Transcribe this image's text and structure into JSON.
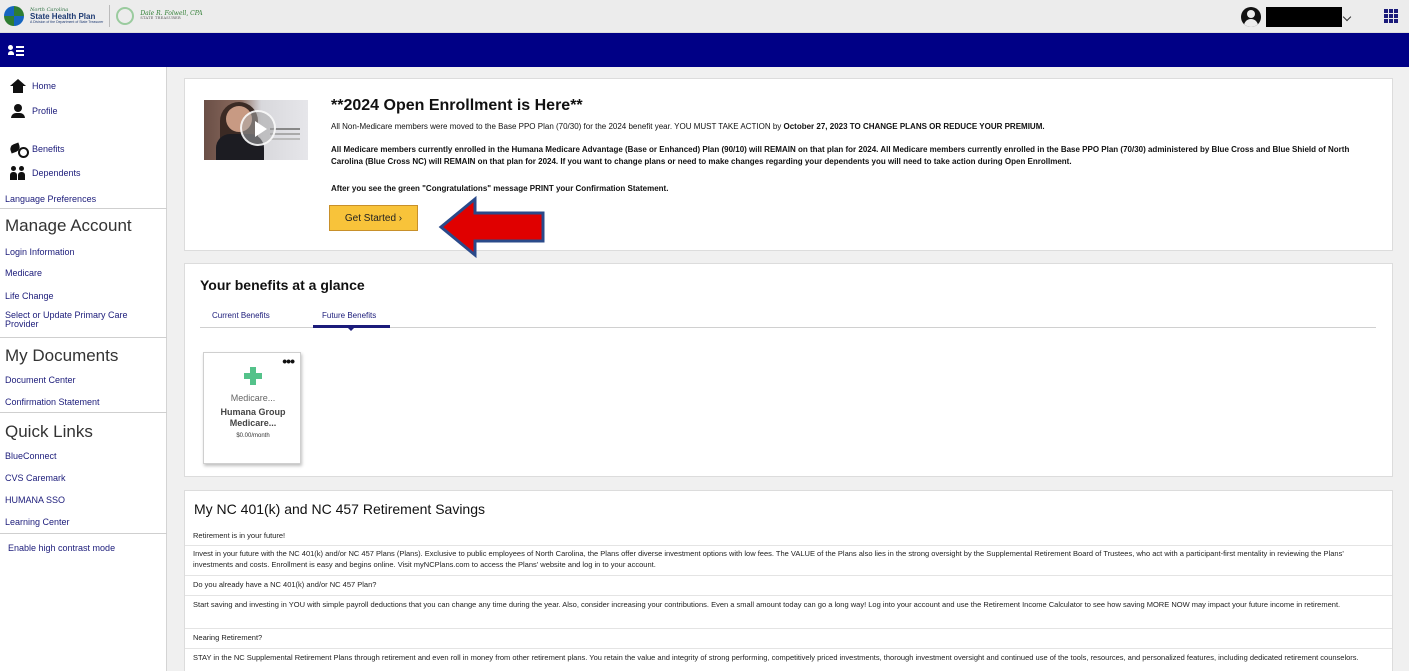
{
  "header": {
    "logo": {
      "tagline_top": "North Carolina",
      "name": "State Health Plan",
      "subtitle": "A Division of the Department of State Treasurer",
      "signature": "Dale R. Folwell, CPA",
      "signature_sub": "STATE TREASURER"
    }
  },
  "sidebar": {
    "nav": [
      {
        "label": "Home",
        "icon": "home-icon"
      },
      {
        "label": "Profile",
        "icon": "profile-icon"
      },
      {
        "label": "Benefits",
        "icon": "benefits-icon"
      },
      {
        "label": "Dependents",
        "icon": "dependents-icon"
      }
    ],
    "language": "Language Preferences",
    "manage_heading": "Manage Account",
    "manage_items": [
      "Login Information",
      "Medicare",
      "Life Change",
      "Select or Update Primary Care Provider"
    ],
    "documents_heading": "My Documents",
    "documents_items": [
      "Document Center",
      "Confirmation Statement"
    ],
    "quick_heading": "Quick Links",
    "quick_items": [
      "BlueConnect",
      "CVS Caremark",
      "HUMANA SSO",
      "Learning Center"
    ],
    "contrast": "Enable high contrast mode"
  },
  "enrollment": {
    "title": "**2024 Open Enrollment is Here**",
    "p1_normal": "All Non-Medicare members were moved to the Base PPO Plan (70/30) for the 2024 benefit year. YOU MUST TAKE ACTION by ",
    "p1_bold": "October 27, 2023 TO CHANGE PLANS OR REDUCE YOUR PREMIUM.",
    "p2": "All Medicare members currently enrolled in the Humana Medicare Advantage (Base or Enhanced) Plan (90/10) will REMAIN on that plan for 2024. All Medicare members currently enrolled in the Base PPO Plan (70/30) administered by Blue Cross and Blue Shield of North Carolina (Blue Cross NC) will REMAIN on that plan for 2024. If you want to change plans or need to make changes regarding your dependents you will need to take action during Open Enrollment.",
    "p3": "After you see the green \"Congratulations\" message PRINT your Confirmation Statement.",
    "button": "Get Started ›"
  },
  "glance": {
    "title": "Your benefits at a glance",
    "tabs": [
      "Current Benefits",
      "Future Benefits"
    ],
    "active_tab": "Future Benefits",
    "tile": {
      "more": "•••",
      "type": "Medicare...",
      "name_line1": "Humana Group",
      "name_line2": "Medicare...",
      "cost": "$0.00/month"
    }
  },
  "retirement": {
    "title": "My NC 401(k) and NC 457 Retirement Savings",
    "rows": [
      "Retirement is in your future!",
      "Invest in your future with the NC 401(k) and/or NC 457 Plans (Plans). Exclusive to public employees of North Carolina, the Plans offer diverse investment options with low fees. The VALUE of the Plans also lies in the strong oversight by the Supplemental Retirement Board of Trustees, who act with a participant-first mentality in reviewing the Plans' investments and costs. Enrollment is easy and begins online. Visit myNCPlans.com to access the Plans' website and log in to your account.",
      "Do you already have a NC 401(k) and/or NC 457 Plan?",
      "Start saving and investing in YOU with simple payroll deductions that you can change any time during the year. Also, consider increasing your contributions. Even a small amount today can go a long way! Log into your account and use the Retirement Income Calculator to see how saving MORE NOW may impact your future income in retirement.",
      "Nearing Retirement?",
      "STAY in the NC Supplemental Retirement Plans through retirement and even roll in money from other retirement plans. You retain the value and integrity of strong performing, competitively priced investments, thorough investment oversight and continued use of the tools, resources, and personalized features, including dedicated retirement counselors."
    ]
  },
  "colors": {
    "navy": "#000086",
    "link": "#1b1b7a",
    "button": "#f8c33a",
    "arrow": "#e00000",
    "plus": "#54c28a"
  }
}
